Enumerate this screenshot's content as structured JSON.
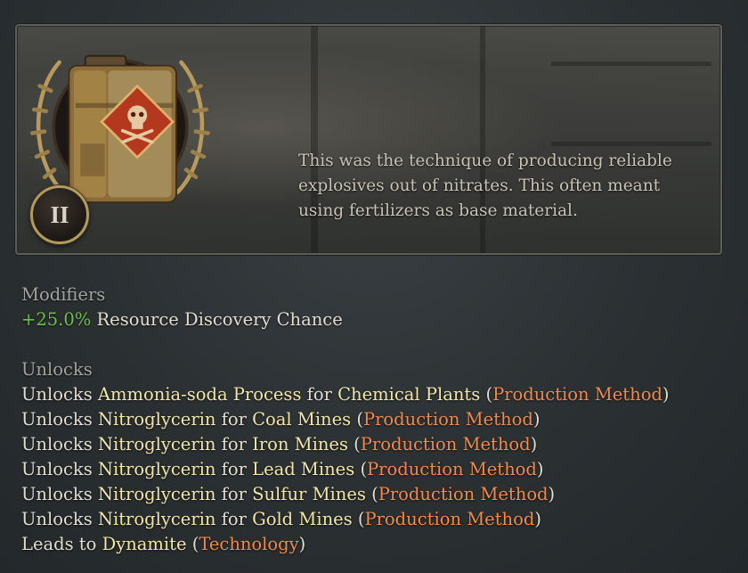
{
  "tech": {
    "tier_numeral": "II",
    "description": "This was the technique of producing reliable explosives out of nitrates. This often meant using fertilizers as base material."
  },
  "modifiers": {
    "heading": "Modifiers",
    "items": [
      {
        "value": "+25.0%",
        "label": "Resource Discovery Chance"
      }
    ]
  },
  "unlocks": {
    "heading": "Unlocks",
    "items": [
      {
        "prefix": "Unlocks",
        "name": "Ammonia-soda Process",
        "connector": "for",
        "target": "Chemical Plants",
        "kind": "Production Method"
      },
      {
        "prefix": "Unlocks",
        "name": "Nitroglycerin",
        "connector": "for",
        "target": "Coal Mines",
        "kind": "Production Method"
      },
      {
        "prefix": "Unlocks",
        "name": "Nitroglycerin",
        "connector": "for",
        "target": "Iron Mines",
        "kind": "Production Method"
      },
      {
        "prefix": "Unlocks",
        "name": "Nitroglycerin",
        "connector": "for",
        "target": "Lead Mines",
        "kind": "Production Method"
      },
      {
        "prefix": "Unlocks",
        "name": "Nitroglycerin",
        "connector": "for",
        "target": "Sulfur Mines",
        "kind": "Production Method"
      },
      {
        "prefix": "Unlocks",
        "name": "Nitroglycerin",
        "connector": "for",
        "target": "Gold Mines",
        "kind": "Production Method"
      }
    ],
    "leads_to": {
      "prefix": "Leads to",
      "name": "Dynamite",
      "kind": "Technology"
    }
  },
  "colors": {
    "positive": "#6fbf4a",
    "highlight": "#f2e6a8",
    "link": "#f08a4e",
    "heading": "#a3a39b"
  },
  "icons": {
    "tech_icon": "explosive-canister-icon",
    "hazard": "skull-crossbones-icon"
  }
}
